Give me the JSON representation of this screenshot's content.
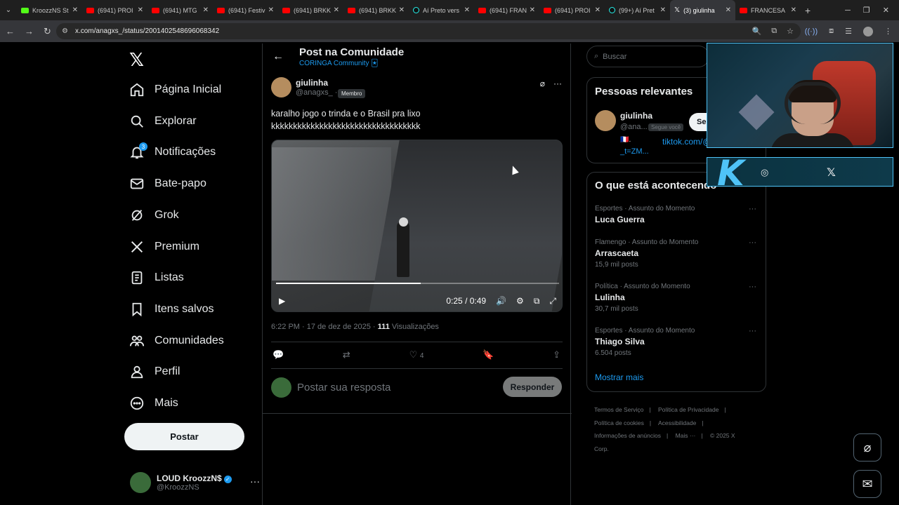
{
  "browser": {
    "tabs": [
      {
        "title": "KroozzNS St",
        "favicon": "kick-icon"
      },
      {
        "title": "(6941) PROI",
        "favicon": "youtube-icon"
      },
      {
        "title": "(6941) MTG",
        "favicon": "youtube-icon"
      },
      {
        "title": "(6941) Festiv",
        "favicon": "youtube-icon"
      },
      {
        "title": "(6941) BRKK",
        "favicon": "youtube-icon"
      },
      {
        "title": "(6941) BRKK",
        "favicon": "youtube-icon"
      },
      {
        "title": "Aí Preto vers",
        "favicon": "tiktok-icon"
      },
      {
        "title": "(6941) FRAN",
        "favicon": "youtube-icon"
      },
      {
        "title": "(6941) PROI",
        "favicon": "youtube-icon"
      },
      {
        "title": "(99+) Aí Pret",
        "favicon": "tiktok-icon"
      },
      {
        "title": "(3) giulinha",
        "favicon": "x-icon",
        "active": true
      },
      {
        "title": "FRANCESA",
        "favicon": "youtube-icon"
      }
    ],
    "url": "x.com/anagxs_/status/2001402548696068342"
  },
  "nav": {
    "items": [
      {
        "label": "Página Inicial",
        "icon": "home-icon"
      },
      {
        "label": "Explorar",
        "icon": "search-icon"
      },
      {
        "label": "Notificações",
        "icon": "bell-icon",
        "badge": "3"
      },
      {
        "label": "Bate-papo",
        "icon": "mail-icon"
      },
      {
        "label": "Grok",
        "icon": "grok-icon"
      },
      {
        "label": "Premium",
        "icon": "x-icon"
      },
      {
        "label": "Listas",
        "icon": "list-icon"
      },
      {
        "label": "Itens salvos",
        "icon": "bookmark-icon"
      },
      {
        "label": "Comunidades",
        "icon": "people-icon"
      },
      {
        "label": "Perfil",
        "icon": "person-icon"
      },
      {
        "label": "Mais",
        "icon": "more-circle-icon"
      }
    ],
    "post_button": "Postar",
    "account": {
      "name": "LOUD KroozzN$",
      "handle": "@KroozzNS"
    }
  },
  "header": {
    "title": "Post na Comunidade",
    "subtitle": "CORINGA Community 🃏"
  },
  "post": {
    "name": "giulinha",
    "handle": "@anagxs_ ·",
    "member_badge": "Membro",
    "text_line1": "karalho jogo o trinda e o Brasil pra lixo",
    "text_line2": "kkkkkkkkkkkkkkkkkkkkkkkkkkkkkkkkkk",
    "video": {
      "time": "0:25 / 0:49",
      "progress": 0.51
    },
    "time": "6:22 PM · 17 de dez de 2025 ·",
    "views_count": "111",
    "views_label": "Visualizações",
    "likes": "4"
  },
  "reply": {
    "placeholder": "Postar sua resposta",
    "button": "Responder"
  },
  "right": {
    "search_placeholder": "Buscar",
    "relevant": {
      "title": "Pessoas relevantes",
      "name": "giulinha",
      "handle": "@ana...",
      "follows_you": "Segue você",
      "follow_btn": "Se",
      "flag": "🇫🇷.",
      "link": "tiktok.com/@",
      "link2": "_t=ZM..."
    },
    "trending": {
      "title": "O que está acontecendo",
      "items": [
        {
          "category": "Esportes · Assunto do Momento",
          "name": "Luca Guerra",
          "count": ""
        },
        {
          "category": "Flamengo · Assunto do Momento",
          "name": "Arrascaeta",
          "count": "15,9 mil posts"
        },
        {
          "category": "Política · Assunto do Momento",
          "name": "Lulinha",
          "count": "30,7 mil posts"
        },
        {
          "category": "Esportes · Assunto do Momento",
          "name": "Thiago Silva",
          "count": "6.504 posts"
        }
      ],
      "show_more": "Mostrar mais"
    },
    "footer": {
      "terms": "Termos de Serviço",
      "privacy": "Política de Privacidade",
      "cookies": "Política de cookies",
      "accessibility": "Acessibilidade",
      "ads": "Informações de anúncios",
      "more": "Mais ···",
      "copyright": "© 2025 X Corp."
    }
  },
  "colors": {
    "accent": "#1d9bf0",
    "bg": "#000000",
    "border": "#2f3336",
    "overlay_accent": "#4fc3f7"
  }
}
